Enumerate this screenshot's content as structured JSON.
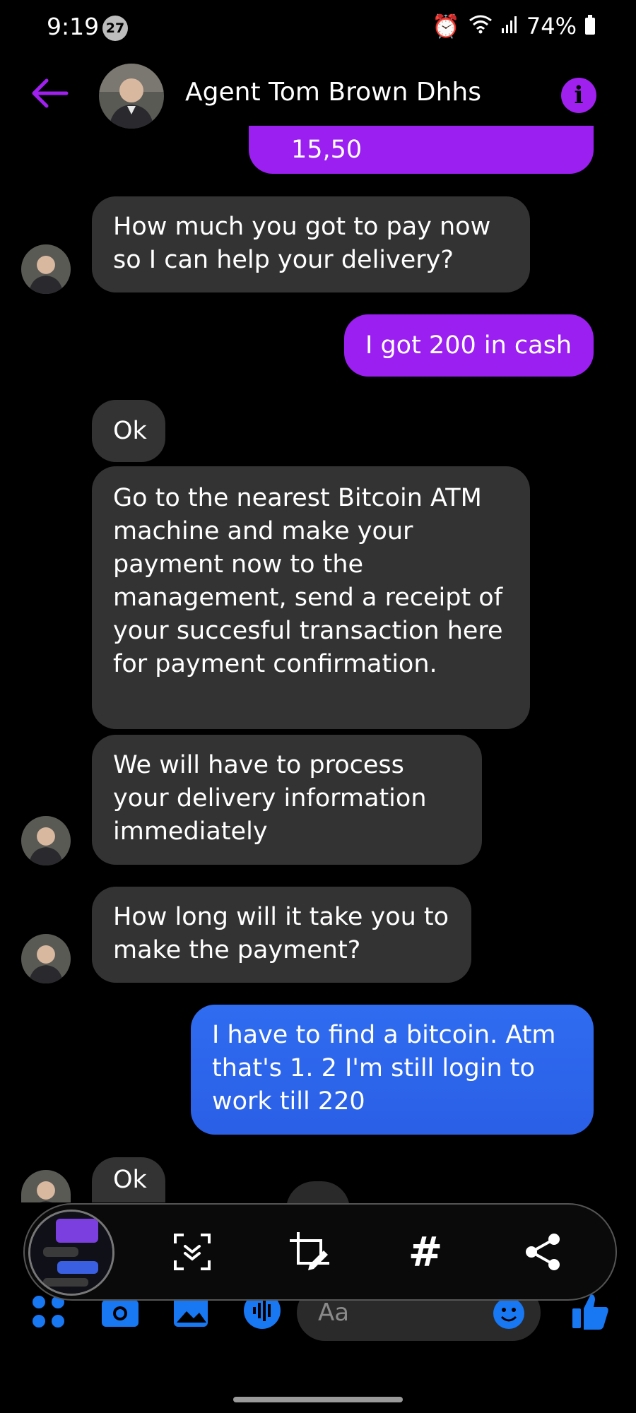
{
  "status_bar": {
    "time": "9:19",
    "notification_count": "27",
    "battery": "74%"
  },
  "header": {
    "contact_name": "Agent Tom Brown Dhhs",
    "info_label": "i"
  },
  "messages": [
    {
      "id": "m0",
      "direction": "outgoing",
      "text": "15,50"
    },
    {
      "id": "m1",
      "direction": "incoming",
      "text": "How much you got to pay now so I can help your delivery?"
    },
    {
      "id": "m2",
      "direction": "outgoing",
      "text": "I got 200 in cash"
    },
    {
      "id": "m3",
      "direction": "incoming",
      "text": "Ok"
    },
    {
      "id": "m4",
      "direction": "incoming",
      "text": "Go to the nearest Bitcoin ATM machine and make your payment now to the management, send a receipt of your succesful transaction here for payment confirmation."
    },
    {
      "id": "m5",
      "direction": "incoming",
      "text": "We will have to process your delivery information immediately"
    },
    {
      "id": "m6",
      "direction": "incoming",
      "text": "How long will it take you to make the payment?"
    },
    {
      "id": "m7",
      "direction": "outgoing",
      "text": "I have to find a bitcoin. Atm that's 1. 2 I'm still login to work till 220"
    },
    {
      "id": "m8",
      "direction": "incoming",
      "text": "Ok"
    }
  ],
  "composer": {
    "placeholder": "Aa"
  },
  "screenshot_toolbar": {
    "hashtag_label": "#"
  },
  "colors": {
    "outgoing_purple": "#9b1ff0",
    "outgoing_blue": "#2f6cf0",
    "incoming": "#333333",
    "accent_blue": "#1877f2",
    "accent_purple": "#a020f0"
  },
  "icons": [
    "back-arrow-icon",
    "info-icon",
    "scroll-capture-icon",
    "crop-edit-icon",
    "hashtag-icon",
    "share-icon",
    "menu-dots-icon",
    "camera-icon",
    "gallery-icon",
    "voice-icon",
    "emoji-icon",
    "thumbs-up-icon"
  ]
}
